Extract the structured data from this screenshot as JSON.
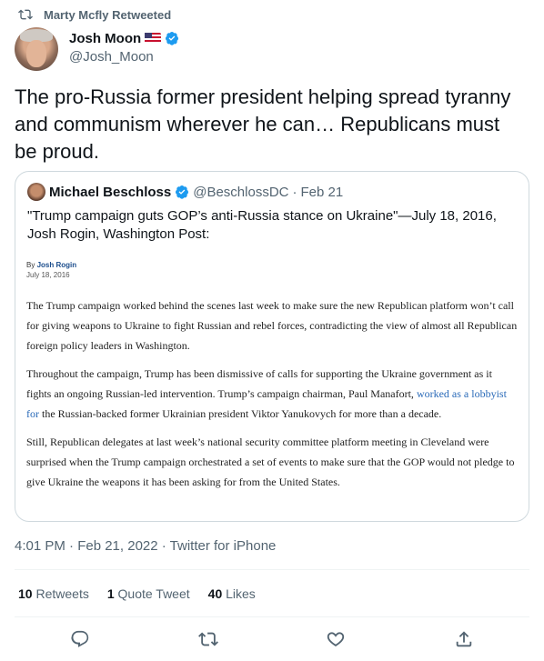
{
  "retweet_line": {
    "text": "Marty Mcfly Retweeted",
    "icon": "retweet-icon"
  },
  "author": {
    "display_name": "Josh Moon",
    "handle": "@Josh_Moon",
    "flag": "us-flag-icon",
    "verified": true
  },
  "tweet": {
    "text": "The pro-Russia former president helping spread tyranny and communism wherever he can… Republicans must be proud."
  },
  "quoted": {
    "display_name": "Michael Beschloss",
    "handle": "@BeschlossDC",
    "separator": "·",
    "date": "Feb 21",
    "text": "\"Trump campaign guts GOP’s anti-Russia stance on Ukraine\"—July 18, 2016, Josh Rogin, Washington Post:",
    "article": {
      "byline_prefix": "By",
      "byline_author": "Josh Rogin",
      "date": "July 18, 2016",
      "p1": "The Trump campaign worked behind the scenes last week to make sure the new Republican platform won’t call for giving weapons to Ukraine to fight Russian and rebel forces, contradicting the view of almost all Republican foreign policy leaders in Washington.",
      "p2_before": "Throughout the campaign, Trump has been dismissive of calls for supporting the Ukraine government as it fights an ongoing Russian-led intervention. Trump’s campaign chairman, Paul Manafort, ",
      "p2_link": "worked as a lobbyist for",
      "p2_after": " the Russian-backed former Ukrainian president Viktor Yanukovych for more than a decade.",
      "p3": "Still, Republican delegates at last week’s national security committee platform meeting in Cleveland were surprised when the Trump campaign orchestrated a set of events to make sure that the GOP would not pledge to give Ukraine the weapons it has been asking for from the United States."
    }
  },
  "timestamp": "4:01 PM · Feb 21, 2022 · Twitter for iPhone",
  "stats": {
    "retweets_count": "10",
    "retweets_label": "Retweets",
    "quotes_count": "1",
    "quotes_label": "Quote Tweet",
    "likes_count": "40",
    "likes_label": "Likes"
  },
  "actions": [
    "reply-icon",
    "retweet-icon",
    "like-icon",
    "share-icon"
  ],
  "colors": {
    "verified_blue": "#1d9bf0",
    "secondary_text": "#536471",
    "link": "#2a6ab8"
  }
}
